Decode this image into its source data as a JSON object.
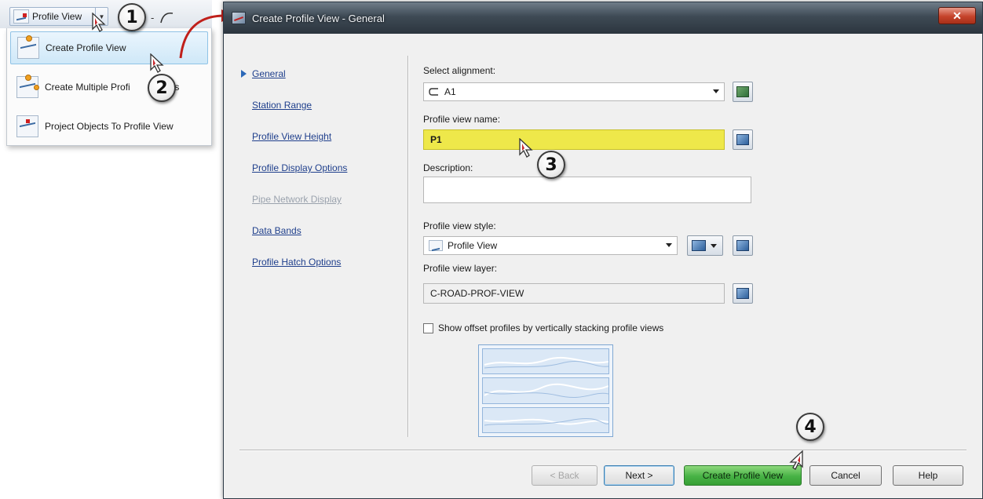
{
  "ribbon": {
    "profile_view_label": "Profile View",
    "menu_items": [
      {
        "label": "Create Profile View",
        "highlighted": true
      },
      {
        "label": "Create Multiple Profi",
        "highlighted": false
      },
      {
        "label": "Project Objects To Profile View",
        "highlighted": false
      }
    ],
    "partial_text": "ws"
  },
  "callouts": [
    "1",
    "2",
    "3",
    "4"
  ],
  "dialog": {
    "title": "Create Profile View - General",
    "close_label": "✕",
    "nav": [
      {
        "label": "General",
        "current": true,
        "enabled": true
      },
      {
        "label": "Station Range",
        "current": false,
        "enabled": true
      },
      {
        "label": "Profile View Height",
        "current": false,
        "enabled": true
      },
      {
        "label": "Profile Display Options",
        "current": false,
        "enabled": true
      },
      {
        "label": "Pipe Network Display",
        "current": false,
        "enabled": false
      },
      {
        "label": "Data Bands",
        "current": false,
        "enabled": true
      },
      {
        "label": "Profile Hatch Options",
        "current": false,
        "enabled": true
      }
    ],
    "fields": {
      "select_alignment_label": "Select alignment:",
      "select_alignment_value": "A1",
      "profile_view_name_label": "Profile view name:",
      "profile_view_name_value": "P1",
      "description_label": "Description:",
      "description_value": "",
      "profile_view_style_label": "Profile view style:",
      "profile_view_style_value": "Profile View",
      "profile_view_layer_label": "Profile view layer:",
      "profile_view_layer_value": "C-ROAD-PROF-VIEW",
      "stacking_checkbox_label": "Show offset profiles by vertically stacking profile views",
      "stacking_checked": false
    },
    "buttons": {
      "back": "< Back",
      "next": "Next >",
      "create": "Create Profile View",
      "cancel": "Cancel",
      "help": "Help"
    }
  },
  "colors": {
    "highlight_yellow": "#eee84a",
    "primary_green": "#47b245",
    "link_blue": "#1f3f8c",
    "connector_red": "#c0201b"
  },
  "icons": [
    "profile-view-icon",
    "alignment-icon",
    "pick-from-drawing-icon",
    "style-edit-icon",
    "layer-icon",
    "close-icon",
    "mouse-cursor-icon"
  ]
}
